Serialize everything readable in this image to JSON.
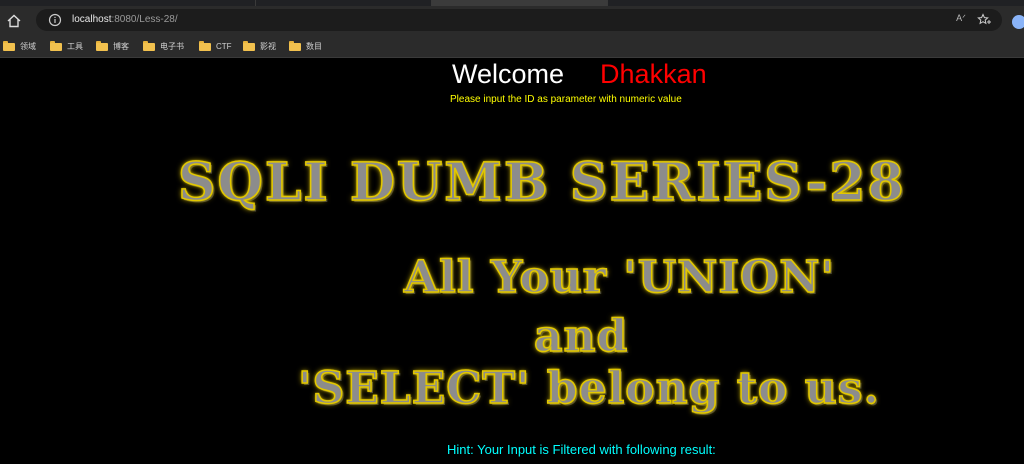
{
  "browser": {
    "url_host": "localhost",
    "url_rest": ":8080/Less-28/",
    "read_aloud": "Aͅ",
    "bookmarks": [
      "领域",
      "工具",
      "博客",
      "电子书",
      "CTF",
      "影视",
      "数目"
    ]
  },
  "page": {
    "welcome": "Welcome",
    "name": "Dhakkan",
    "instruction": "Please input the ID as parameter with numeric value",
    "title": "SQLI DUMB SERIES-28",
    "line1": "All Your 'UNION'",
    "line2": "and",
    "line3": "'SELECT' belong to us.",
    "hint": "Hint: Your Input is Filtered with following result:"
  },
  "colors": {
    "welcome": "#ffffff",
    "name": "#ff0000",
    "instruction": "#ffff00",
    "hint": "#00ffff",
    "banner_fill": "#8c8c8c",
    "banner_glow": "#e3c800"
  }
}
